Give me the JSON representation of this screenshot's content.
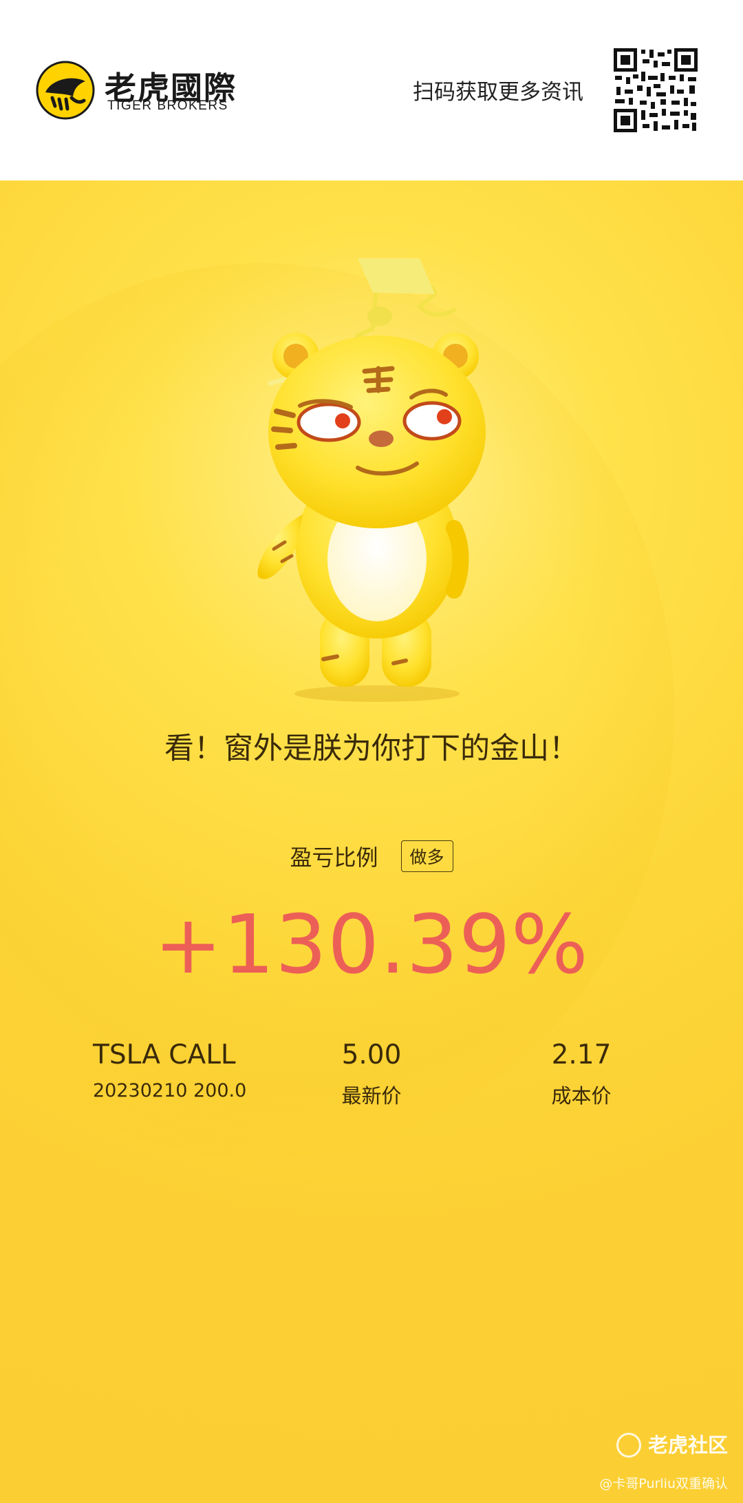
{
  "header": {
    "brand_cn": "老虎國際",
    "brand_en": "TIGER BROKERS",
    "scan_text": "扫码获取更多资讯"
  },
  "poster": {
    "slogan": "看！窗外是朕为你打下的金山！",
    "ratio_label": "盈亏比例",
    "direction_badge": "做多",
    "profit_pct": "+130.39%",
    "stats": {
      "symbol": "TSLA CALL",
      "contract": "20230210 200.0",
      "latest_price": "5.00",
      "latest_price_label": "最新价",
      "cost_price": "2.17",
      "cost_price_label": "成本价"
    }
  },
  "watermark": {
    "title": "老虎社区",
    "sub": "@卡哥Purliu双重确认"
  },
  "colors": {
    "poster_bg": "#fcd034",
    "profit": "#ec5f57",
    "text_dark": "#3a2a0a",
    "logo_yellow": "#ffd200"
  },
  "icons": {
    "logo": "tiger-logo-icon",
    "qr": "qr-code-icon",
    "mascot": "tiger-mascot-illustration",
    "watermark": "tiger-community-icon"
  }
}
